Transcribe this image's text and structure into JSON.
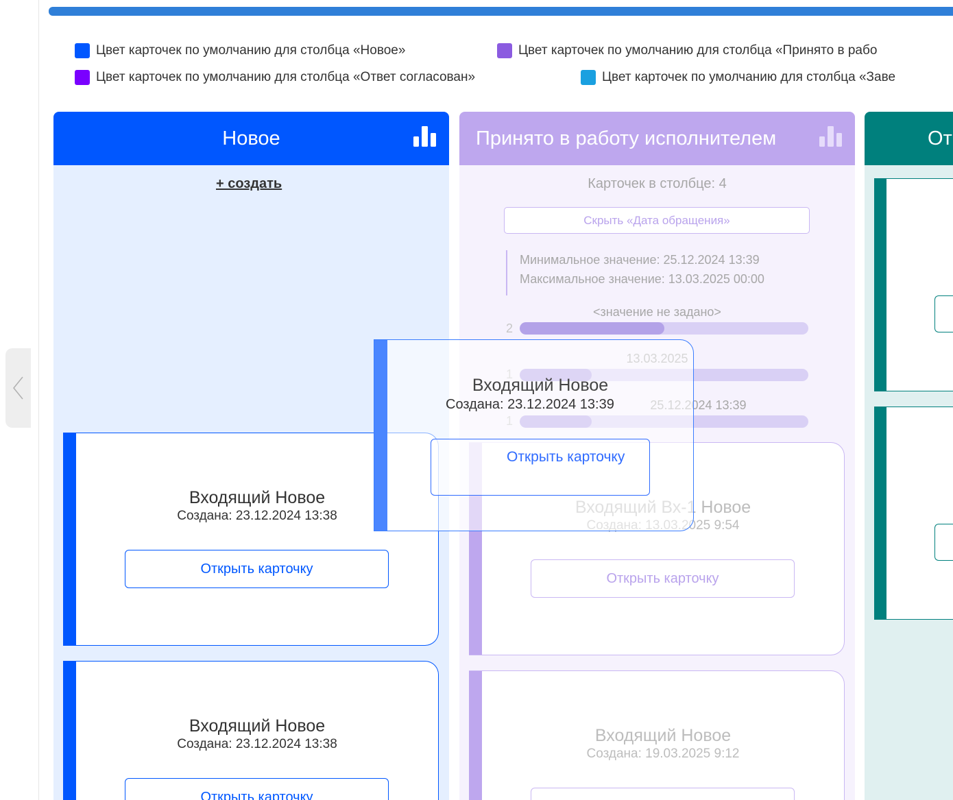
{
  "legend": {
    "row1": [
      {
        "label": "Цвет карточек по умолчанию для столбца «Новое»",
        "color": "#0057ff"
      },
      {
        "label": "Цвет карточек по умолчанию для столбца «Принято в рабо",
        "color": "#8b5be0"
      }
    ],
    "row2": [
      {
        "label": "Цвет карточек по умолчанию для столбца «Ответ согласован»",
        "color": "#7a00ff"
      },
      {
        "label": "Цвет карточек по умолчанию для столбца «Заве",
        "color": "#1aa0e0"
      }
    ]
  },
  "columns": {
    "new": {
      "title": "Новое",
      "color": "#0057ff",
      "create_label": "+ создать",
      "cards": [
        {
          "title": "Входящий Новое",
          "date": "Создана: 23.12.2024 13:38",
          "button": "Открыть карточку"
        },
        {
          "title": "Входящий Новое",
          "date": "Создана: 23.12.2024 13:38",
          "button": "Открыть карточку"
        }
      ]
    },
    "accepted": {
      "title": "Принято в работу исполнителем",
      "color": "#bea7ee",
      "count_label": "Карточек в столбце: 4",
      "hide_button": "Скрыть «Дата обращения»",
      "min_value": "Минимальное значение: 25.12.2024 13:39",
      "max_value": "Максимальное значение: 13.03.2025 00:00",
      "bars": [
        {
          "label": "<значение не задано>",
          "count": "2",
          "fill": 0.5
        },
        {
          "label": "13.03.2025",
          "count": "1",
          "fill": 0.25
        },
        {
          "label": "25.12.2024 13:39",
          "count": "1",
          "fill": 0.25
        }
      ],
      "cards": [
        {
          "title": "Входящий Вх-1 Новое",
          "date": "Создана: 13.03.2025 9:54",
          "button": "Открыть карточку"
        },
        {
          "title": "Входящий Новое",
          "date": "Создана: 19.03.2025 9:12",
          "button": ""
        }
      ]
    },
    "agreed": {
      "title": "От",
      "color": "#00807d"
    }
  },
  "drag_card": {
    "title": "Входящий Новое",
    "date": "Создана: 23.12.2024 13:39",
    "button": "Открыть карточку"
  }
}
